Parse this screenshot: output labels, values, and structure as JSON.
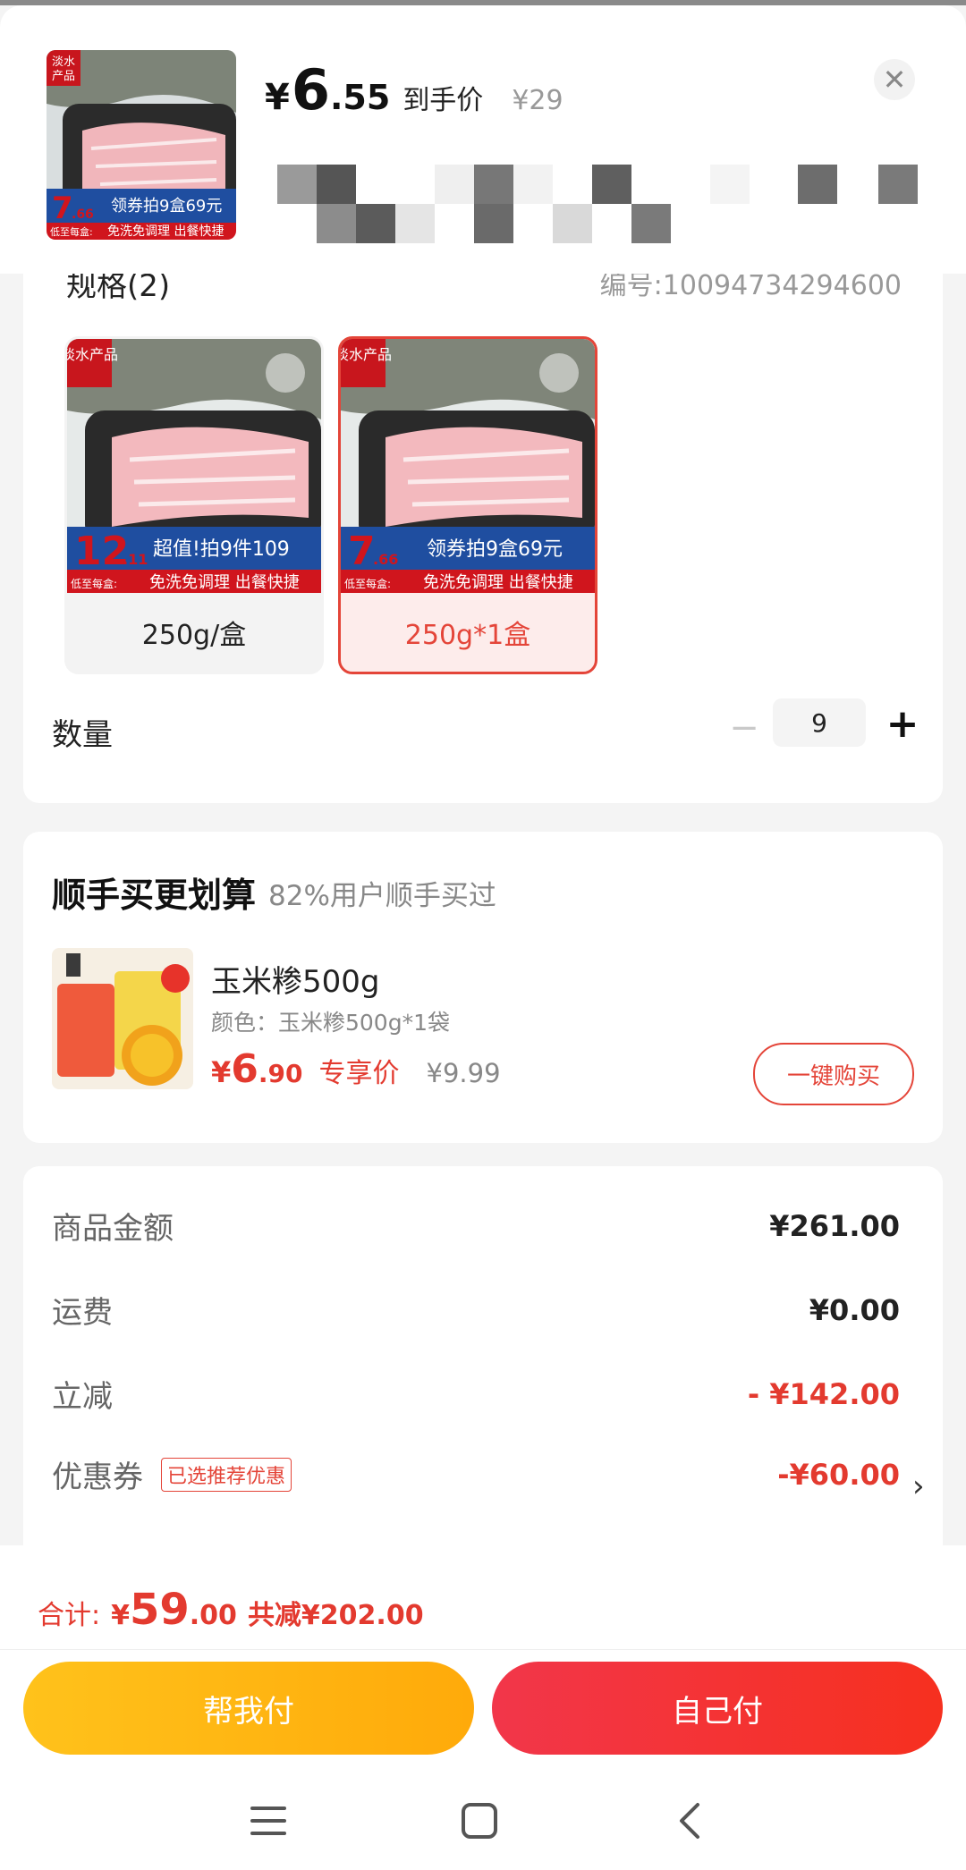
{
  "header": {
    "product_tag": "淡水产品",
    "price_currency": "¥",
    "price_integer": "6",
    "price_decimal": ".55",
    "price_label": "到手价",
    "original_price": "¥29",
    "close_label": "✕"
  },
  "spec": {
    "title": "规格(2)",
    "sku": "编号:10094734294600",
    "options": [
      {
        "label": "250g/盒",
        "badge": "淡水产品",
        "price_int": "12",
        "price_dec": ".11",
        "promo": "超值!拍9件109",
        "tagline": "免洗免调理 出餐快捷",
        "low_label": "低至每盒:",
        "selected": false
      },
      {
        "label": "250g*1盒",
        "badge": "淡水产品",
        "price_int": "7",
        "price_dec": ".66",
        "promo": "领券拍9盒69元",
        "tagline": "免洗免调理 出餐快捷",
        "low_label": "低至每盒:",
        "selected": true
      }
    ],
    "quantity_label": "数量",
    "quantity_value": "9",
    "minus_label": "−",
    "plus_label": "+"
  },
  "upsell": {
    "title": "顺手买更划算",
    "subtitle": "82%用户顺手买过",
    "product": {
      "name": "玉米糁500g",
      "attribute": "颜色：玉米糁500g*1袋",
      "price_currency": "¥",
      "price_integer": "6",
      "price_decimal": ".90",
      "price_tag": "专享价",
      "original_price": "¥9.99",
      "buy_label": "一键购买"
    }
  },
  "summary": {
    "rows": [
      {
        "label": "商品金额",
        "value": "¥261.00"
      },
      {
        "label": "运费",
        "value": "¥0.00"
      },
      {
        "label": "立减",
        "value": "- ¥142.00"
      },
      {
        "label": "优惠券",
        "value": "-¥60.00",
        "badge": "已选推荐优惠"
      }
    ]
  },
  "footer": {
    "total_label": "合计:",
    "total_currency": "¥",
    "total_integer": "59",
    "total_decimal": ".00",
    "saved_text": "共减¥202.00",
    "help_pay_label": "帮我付",
    "self_pay_label": "自己付"
  },
  "colors": {
    "accent_red": "#e33a2f",
    "help_button": "#ffb512",
    "pay_button": "#f2343a"
  }
}
